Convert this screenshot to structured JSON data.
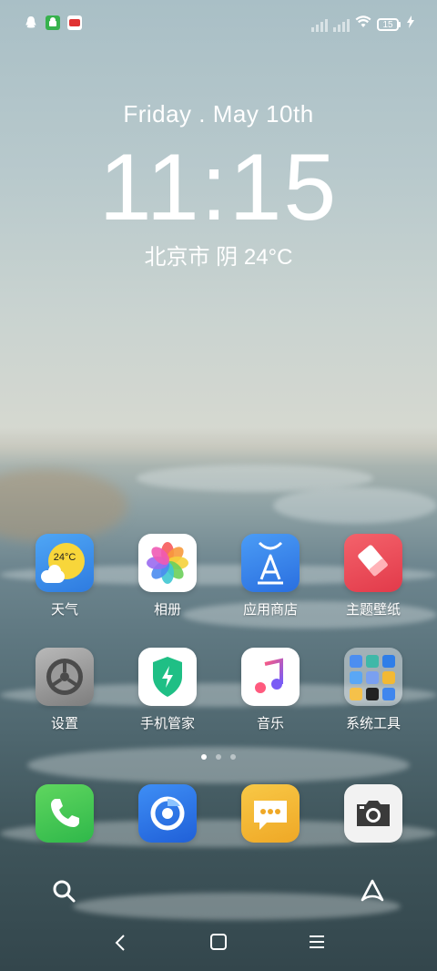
{
  "status_bar": {
    "battery_level": "15",
    "icons": [
      "qq-icon",
      "android-icon",
      "app-badge-icon",
      "signal-icon",
      "signal-icon",
      "wifi-icon",
      "battery-icon",
      "charging-icon"
    ]
  },
  "lockscreen": {
    "date": "Friday . May 10th",
    "time": "11:15",
    "weather": "北京市 阴 24°C"
  },
  "apps_row1": [
    {
      "label": "天气",
      "badge": "24°C"
    },
    {
      "label": "相册"
    },
    {
      "label": "应用商店"
    },
    {
      "label": "主题壁纸"
    }
  ],
  "apps_row2": [
    {
      "label": "设置"
    },
    {
      "label": "手机管家"
    },
    {
      "label": "音乐"
    },
    {
      "label": "系统工具"
    }
  ],
  "page_indicator": {
    "pages": 3,
    "current": 1
  },
  "dock": [
    "phone-icon",
    "browser-icon",
    "messages-icon",
    "camera-icon"
  ],
  "colors": {
    "accent": "#2a7be4",
    "phone": "#4ccb4c",
    "messages": "#f3b934"
  }
}
